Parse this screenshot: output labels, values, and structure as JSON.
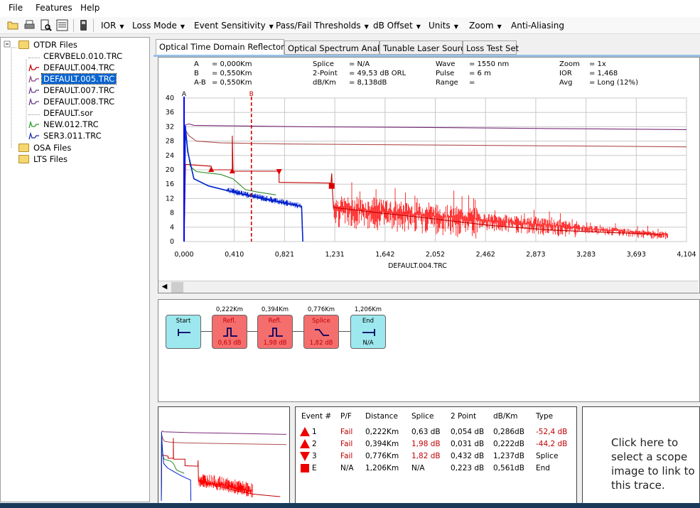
{
  "menu": [
    "File",
    "Features",
    "Help"
  ],
  "toolbar": {
    "menus": [
      "IOR",
      "Loss Mode",
      "Event Sensitivity",
      "Pass/Fail Thresholds",
      "dB Offset",
      "Units",
      "Zoom"
    ],
    "anti_aliasing": "Anti-Aliasing",
    "icons": [
      "open-folder-icon",
      "print-icon",
      "print-preview-icon",
      "report-icon",
      "device-icon"
    ]
  },
  "tree": {
    "root": "OTDR Files",
    "files": [
      {
        "name": "CERVBEL0.010.TRC",
        "color": "none"
      },
      {
        "name": "DEFAULT.004.TRC",
        "color": "#c00000"
      },
      {
        "name": "DEFAULT.005.TRC",
        "color": "#8b4080",
        "selected": true
      },
      {
        "name": "DEFAULT.007.TRC",
        "color": "#6a3a8a"
      },
      {
        "name": "DEFAULT.008.TRC",
        "color": "#6a3a8a"
      },
      {
        "name": "DEFAULT.sor",
        "color": "none"
      },
      {
        "name": "NEW.012.TRC",
        "color": "#2a9a2a"
      },
      {
        "name": "SER3.011.TRC",
        "color": "#1a2aaa"
      }
    ],
    "folders": [
      "OSA Files",
      "LTS Files"
    ]
  },
  "tabs": [
    "Optical Time Domain Reflectometer",
    "Optical Spectrum Analyzer",
    "Tunable Laser Source",
    "Loss Test Set"
  ],
  "info": {
    "col1": [
      [
        "A",
        "= 0,000Km"
      ],
      [
        "B",
        "= 0,550Km"
      ],
      [
        "A-B",
        "= 0,550Km"
      ]
    ],
    "col2": [
      [
        "Splice",
        "= N/A"
      ],
      [
        "2-Point",
        "= 49,53 dB ORL"
      ],
      [
        "dB/Km",
        "= 8,138dB"
      ]
    ],
    "col3": [
      [
        "Wave",
        "= 1550 nm"
      ],
      [
        "Pulse",
        "= 6 m"
      ],
      [
        "Range",
        "="
      ]
    ],
    "col4": [
      [
        "Zoom",
        "= 1x"
      ],
      [
        "IOR",
        "= 1,468"
      ],
      [
        "Avg",
        "= Long (12%)"
      ]
    ]
  },
  "chart_data": {
    "type": "line",
    "title": "",
    "xlabel": "DEFAULT.004.TRC",
    "ylabel": "",
    "x_ticks": [
      "0,000",
      "0,410",
      "0,821",
      "1,231",
      "1,642",
      "2,052",
      "2,462",
      "2,873",
      "3,283",
      "3,693",
      "4,104"
    ],
    "y_ticks": [
      "0",
      "4",
      "8",
      "12",
      "16",
      "20",
      "24",
      "28",
      "32",
      "36",
      "40"
    ],
    "xlim": [
      0,
      4.104
    ],
    "ylim": [
      0,
      40
    ],
    "grid": true,
    "cursors": [
      {
        "label": "A",
        "x": 0.0,
        "color": "#0000ff"
      },
      {
        "label": "B",
        "x": 0.55,
        "color": "#cc0000"
      }
    ],
    "series": [
      {
        "color": "#7a2a7a",
        "points": [
          [
            0,
            0
          ],
          [
            0.01,
            32.5
          ],
          [
            0.04,
            32.8
          ],
          [
            0.08,
            32.4
          ],
          [
            1.0,
            32.0
          ],
          [
            2.0,
            31.8
          ],
          [
            3.0,
            31.5
          ],
          [
            4.104,
            31.2
          ]
        ]
      },
      {
        "color": "#b05050",
        "points": [
          [
            0,
            0
          ],
          [
            0.012,
            31
          ],
          [
            0.04,
            29.5
          ],
          [
            0.1,
            28
          ],
          [
            0.3,
            27.5
          ],
          [
            0.8,
            27.2
          ],
          [
            1.6,
            27.0
          ],
          [
            2.5,
            26.8
          ],
          [
            3.4,
            26.6
          ],
          [
            4.104,
            26.4
          ]
        ]
      },
      {
        "color": "#c00000",
        "points": [
          [
            0,
            0
          ],
          [
            0.012,
            21.5
          ],
          [
            0.222,
            21.0
          ],
          [
            0.222,
            20.0
          ],
          [
            0.394,
            20.0
          ],
          [
            0.394,
            29.5
          ],
          [
            0.4,
            19.6
          ],
          [
            0.776,
            19.6
          ],
          [
            0.776,
            16.5
          ],
          [
            1.2,
            16.3
          ],
          [
            1.206,
            19.0
          ],
          [
            1.21,
            15.5
          ],
          [
            1.22,
            9.5
          ],
          [
            1.6,
            8.0
          ],
          [
            2.0,
            6.5
          ],
          [
            2.5,
            4.5
          ],
          [
            3.0,
            3.2
          ],
          [
            3.5,
            2.5
          ],
          [
            3.9,
            2.0
          ]
        ]
      },
      {
        "color": "#2a8a2a",
        "points": [
          [
            0,
            0
          ],
          [
            0.012,
            30
          ],
          [
            0.05,
            21
          ],
          [
            0.1,
            19.5
          ],
          [
            0.3,
            18.7
          ],
          [
            0.4,
            17.5
          ],
          [
            0.5,
            14.5
          ],
          [
            0.6,
            13.8
          ],
          [
            0.75,
            13.0
          ]
        ]
      },
      {
        "color": "#0022cc",
        "points": [
          [
            0,
            0
          ],
          [
            0.01,
            32.3
          ],
          [
            0.03,
            25
          ],
          [
            0.08,
            17.5
          ],
          [
            0.2,
            15.5
          ],
          [
            0.4,
            13.8
          ],
          [
            0.6,
            12.2
          ],
          [
            0.8,
            10.8
          ],
          [
            0.96,
            9.8
          ],
          [
            0.97,
            0
          ]
        ]
      }
    ],
    "markers": [
      {
        "shape": "triangle-up",
        "x": 0.222,
        "y": 20.0
      },
      {
        "shape": "triangle-up",
        "x": 0.394,
        "y": 19.6
      },
      {
        "shape": "triangle-down",
        "x": 0.776,
        "y": 19.4
      },
      {
        "shape": "square",
        "x": 1.206,
        "y": 15.5
      }
    ]
  },
  "events_map": [
    {
      "title": "Start",
      "dist": "",
      "sub": "",
      "kind": "start",
      "color": "cyan"
    },
    {
      "title": "Refl.",
      "dist": "0,222Km",
      "sub": "0,63 dB",
      "kind": "refl",
      "color": "red"
    },
    {
      "title": "Refl.",
      "dist": "0,394Km",
      "sub": "1,98 dB",
      "kind": "refl",
      "color": "red"
    },
    {
      "title": "Splice",
      "dist": "0,776Km",
      "sub": "1,82 dB",
      "kind": "splice",
      "color": "red"
    },
    {
      "title": "End",
      "dist": "1,206Km",
      "sub": "N/A",
      "kind": "end",
      "color": "cyan"
    }
  ],
  "table": {
    "headers": [
      "Event #",
      "P/F",
      "Distance",
      "Splice",
      "2 Point",
      "dB/Km",
      "Type"
    ],
    "rows": [
      {
        "marker": "up",
        "num": "1",
        "pf": "Fail",
        "dist": "0,222Km",
        "splice": "0,63 dB",
        "two": "0,054 dB",
        "dbkm": "0,286dB",
        "type": "-52,4 dB",
        "pf_red": true,
        "splice_red": false,
        "type_red": true
      },
      {
        "marker": "up",
        "num": "2",
        "pf": "Fail",
        "dist": "0,394Km",
        "splice": "1,98 dB",
        "two": "0,031 dB",
        "dbkm": "0,222dB",
        "type": "-44,2 dB",
        "pf_red": true,
        "splice_red": true,
        "type_red": true
      },
      {
        "marker": "down",
        "num": "3",
        "pf": "Fail",
        "dist": "0,776Km",
        "splice": "1,82 dB",
        "two": "0,432 dB",
        "dbkm": "1,237dB",
        "type": "Splice",
        "pf_red": true,
        "splice_red": true,
        "type_red": false
      },
      {
        "marker": "square",
        "num": "E",
        "pf": "N/A",
        "dist": "1,206Km",
        "splice": "N/A",
        "two": "0,223 dB",
        "dbkm": "0,561dB",
        "type": "End",
        "pf_red": false,
        "splice_red": false,
        "type_red": false
      }
    ]
  },
  "scope": {
    "text": "Click here to select a scope image to link to this trace."
  }
}
